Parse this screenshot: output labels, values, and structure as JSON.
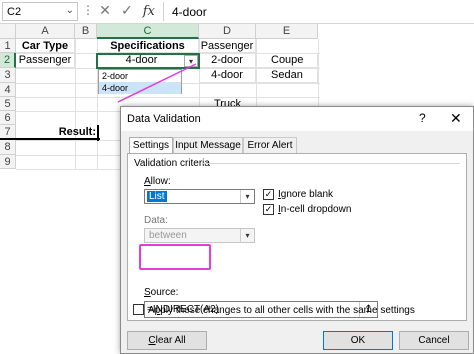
{
  "formula_bar": {
    "name_box": "C2",
    "cancel_symbol": "✕",
    "enter_symbol": "✓",
    "fx_label": "fx",
    "formula": "4-door"
  },
  "columns": [
    "A",
    "B",
    "C",
    "D",
    "E"
  ],
  "rows": [
    "1",
    "2",
    "3",
    "4",
    "5",
    "6",
    "7",
    "8",
    "9"
  ],
  "cells": {
    "A1": "Car Type",
    "C1": "Specifications",
    "D1": "Passenger",
    "A2": "Passenger",
    "C2": "4-door",
    "D2": "2-door",
    "E2": "Coupe",
    "D3": "4-door",
    "E3": "Sedan",
    "D5": "Truck",
    "A7": "Result:"
  },
  "cell_dropdown": {
    "options": [
      "2-door",
      "4-door"
    ],
    "highlighted": "4-door"
  },
  "dialog": {
    "title": "Data Validation",
    "help": "?",
    "close": "✕",
    "tabs": [
      "Settings",
      "Input Message",
      "Error Alert"
    ],
    "active_tab": "Settings",
    "validation_criteria_label": "Validation criteria",
    "allow_label": "Allow:",
    "allow_value": "List",
    "data_label": "Data:",
    "data_value": "between",
    "ignore_blank_label": "Ignore blank",
    "ignore_blank_checked": true,
    "in_cell_dropdown_label": "In-cell dropdown",
    "in_cell_dropdown_checked": true,
    "source_label": "Source:",
    "source_value": "=INDIRECT(A2)",
    "apply_label": "Apply these changes to all other cells with the same settings",
    "apply_checked": false,
    "clear_all": "Clear All",
    "ok": "OK",
    "cancel": "Cancel"
  },
  "colors": {
    "excel_green": "#217346",
    "highlight_magenta": "#e03ee0",
    "selection_blue": "#0078d7"
  }
}
